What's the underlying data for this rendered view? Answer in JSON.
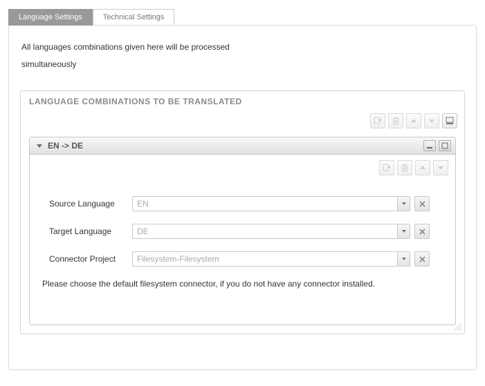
{
  "tabs": {
    "language": "Language Settings",
    "technical": "Technical Settings"
  },
  "intro": {
    "line": "All languages combinations given here will be processed",
    "bold": "simultaneously"
  },
  "section": {
    "title": "LANGUAGE COMBINATIONS TO BE TRANSLATED"
  },
  "pair": {
    "title": "EN -> DE",
    "rows": {
      "source": {
        "label": "Source Language",
        "value": "EN"
      },
      "target": {
        "label": "Target Language",
        "value": "DE"
      },
      "connector": {
        "label": "Connector Project",
        "value": "Filesystem-Filesystem"
      }
    },
    "hint": "Please choose the default filesystem connector, if you do not have any connector installed."
  }
}
